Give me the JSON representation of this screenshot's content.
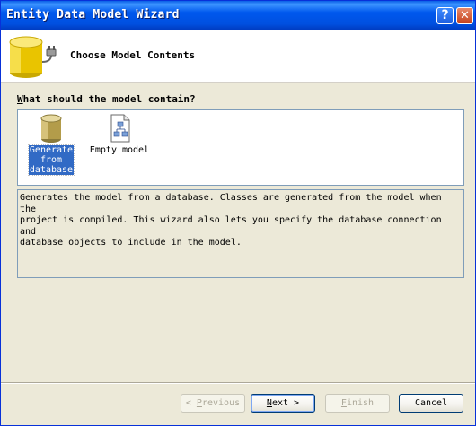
{
  "window": {
    "title": "Entity Data Model Wizard",
    "help_label": "?",
    "close_label": "✕"
  },
  "header": {
    "title": "Choose Model Contents"
  },
  "question": {
    "mnemonic": "W",
    "rest": "hat should the model contain?"
  },
  "options": [
    {
      "line1": "Generate",
      "line2": "from",
      "line3": "database",
      "icon": "database-icon",
      "selected": true
    },
    {
      "label": "Empty model",
      "icon": "empty-model-icon",
      "selected": false
    }
  ],
  "description": "Generates the model from a database. Classes are generated from the model when the\nproject is compiled. This wizard also lets you specify the database connection and\ndatabase objects to include in the model.",
  "buttons": {
    "previous": {
      "prefix": "< ",
      "mnemonic": "P",
      "rest": "revious"
    },
    "next": {
      "mnemonic": "N",
      "rest": "ext >"
    },
    "finish": {
      "mnemonic": "F",
      "rest": "inish"
    },
    "cancel": {
      "label": "Cancel"
    }
  },
  "colors": {
    "accent": "#0054e3",
    "selection": "#316ac5",
    "window_bg": "#ece9d8"
  }
}
